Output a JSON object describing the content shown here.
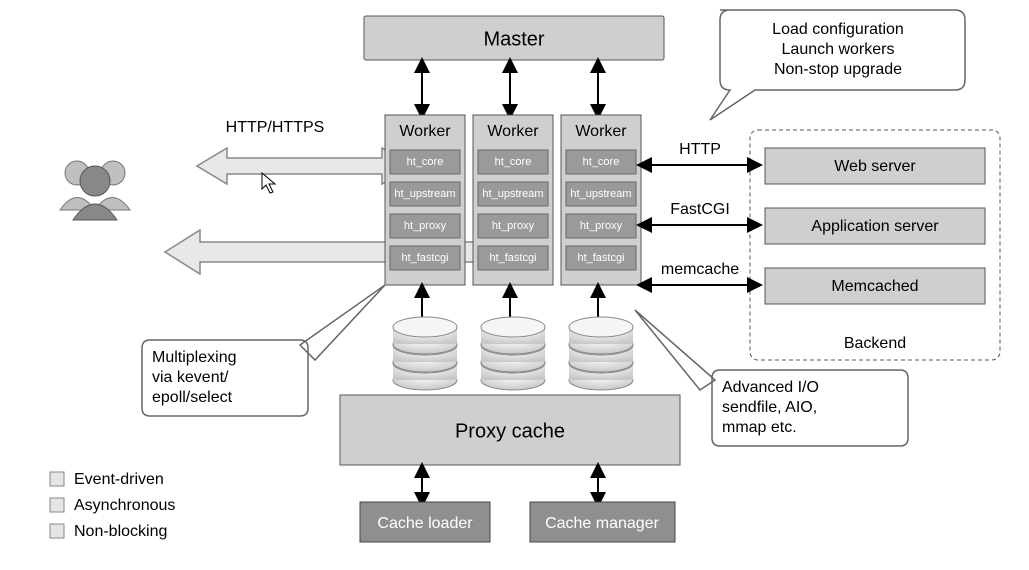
{
  "master": "Master",
  "workers": {
    "title": "Worker",
    "modules": [
      "ht_core",
      "ht_upstream",
      "ht_proxy",
      "ht_fastcgi"
    ]
  },
  "proxy_cache": "Proxy cache",
  "cache_loader": "Cache loader",
  "cache_manager": "Cache manager",
  "backend": {
    "title": "Backend",
    "items": [
      "Web server",
      "Application server",
      "Memcached"
    ],
    "labels": [
      "HTTP",
      "FastCGI",
      "memcache"
    ]
  },
  "client_label": "HTTP/HTTPS",
  "callouts": {
    "master": "Load configuration\nLaunch workers\nNon-stop upgrade",
    "mux": "Multiplexing\nvia kevent/\nepoll/select",
    "io": "Advanced I/O\nsendfile, AIO,\nmmap etc."
  },
  "legend": [
    "Event-driven",
    "Asynchronous",
    "Non-blocking"
  ]
}
